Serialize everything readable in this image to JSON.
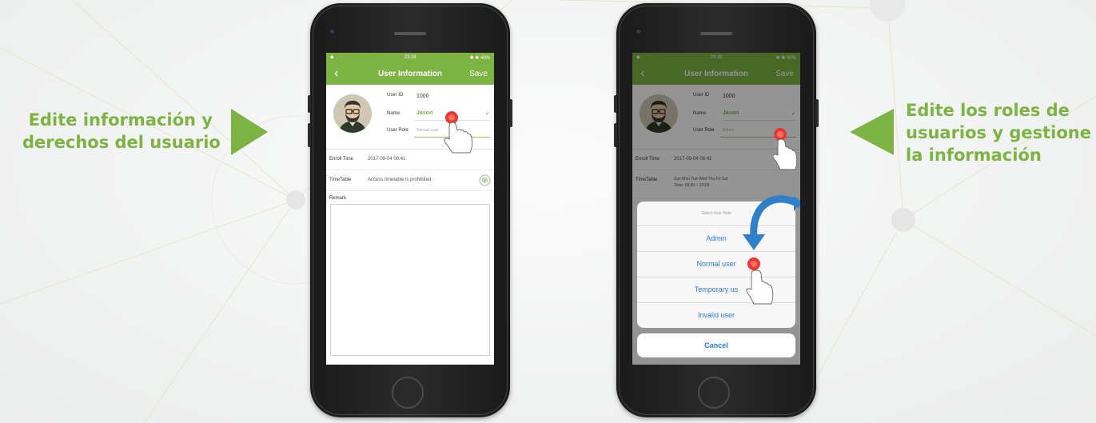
{
  "captions": {
    "left": [
      "Edite información y",
      "derechos del usuario"
    ],
    "right": [
      "Edite los roles de",
      "usuarios y gestione",
      "la información"
    ]
  },
  "icons": [
    "back-arrow-icon",
    "pointing-hand-icon",
    "touch-dot-icon",
    "curved-arrow-icon",
    "fingerprint-icon",
    "checkmark-icon"
  ],
  "colors": {
    "accent": "#7cb342",
    "ios_blue": "#2a7ad8"
  },
  "phone1": {
    "status": {
      "time": "23:18",
      "battery": "✱ ✱ 40%"
    },
    "nav": {
      "back": "‹",
      "title": "User Information",
      "save": "Save"
    },
    "fields": {
      "user_id_label": "User ID",
      "user_id": "1000",
      "name_label": "Name",
      "name": "Jason",
      "role_label": "User Role",
      "role_placeholder": "Normal user"
    },
    "enroll_label": "Enroll Time",
    "enroll_value": "2017-09-04 08:41",
    "timetable_label": "TimeTable",
    "timetable_value": "Access timetable is prohibited",
    "remark_label": "Remark"
  },
  "phone2": {
    "status": {
      "time": "23:18",
      "battery": "✱ ✱ 40%"
    },
    "nav": {
      "back": "‹",
      "title": "User Information",
      "save": "Save"
    },
    "fields": {
      "user_id_label": "User ID",
      "user_id": "1000",
      "name_label": "Name",
      "name": "Jason",
      "role_label": "User Role",
      "role_placeholder": "Admin"
    },
    "enroll_label": "Enroll Time",
    "enroll_value": "2017-09-04 08:41",
    "timetable_label": "TimeTable",
    "timetable_days": "Sun Mon Tue Wed Thu Fri Sat",
    "timetable_time": "Time:  00:00 ~ 23:59",
    "sheet": {
      "title": "Select User Role",
      "options": [
        "Admin",
        "Normal user",
        "Temporary us",
        "Invalid user"
      ],
      "cancel": "Cancel"
    }
  }
}
